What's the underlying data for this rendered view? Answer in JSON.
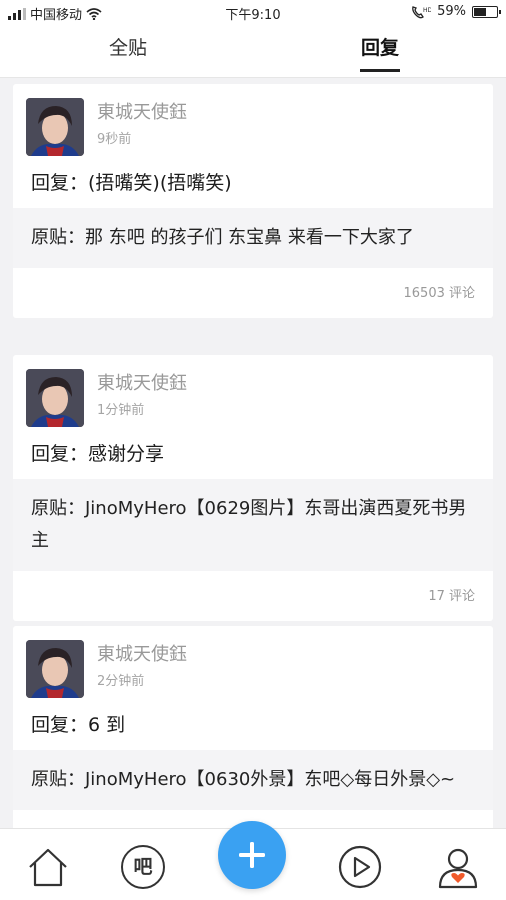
{
  "status_bar": {
    "carrier": "中国移动",
    "time": "下午9:10",
    "battery": "59%",
    "battery_level": 0.59
  },
  "tabs": [
    {
      "label": "全贴",
      "active": false
    },
    {
      "label": "回复",
      "active": true
    }
  ],
  "posts": [
    {
      "user": "東城天使鈺",
      "time": "9秒前",
      "reply": "回复：(捂嘴笑)(捂嘴笑)",
      "original": "原贴：那 东吧 的孩子们 东宝鼻 来看一下大家了",
      "count": "16503 评论"
    },
    {
      "user": "東城天使鈺",
      "time": "1分钟前",
      "reply": "回复：感谢分享",
      "original": "原贴：JinoMyHero【0629图片】东哥出演西夏死书男主",
      "count": "17 评论"
    },
    {
      "user": "東城天使鈺",
      "time": "2分钟前",
      "reply": "回复：6 到",
      "original": "原贴：JinoMyHero【0630外景】东吧◇每日外景◇~",
      "count": ""
    }
  ],
  "bottom_nav": {
    "home": "home-icon",
    "tieba": "吧",
    "add": "plus-icon",
    "video": "play-icon",
    "profile": "profile-icon"
  },
  "colors": {
    "accent": "#3aa1f2",
    "heart": "#f15a2b"
  }
}
